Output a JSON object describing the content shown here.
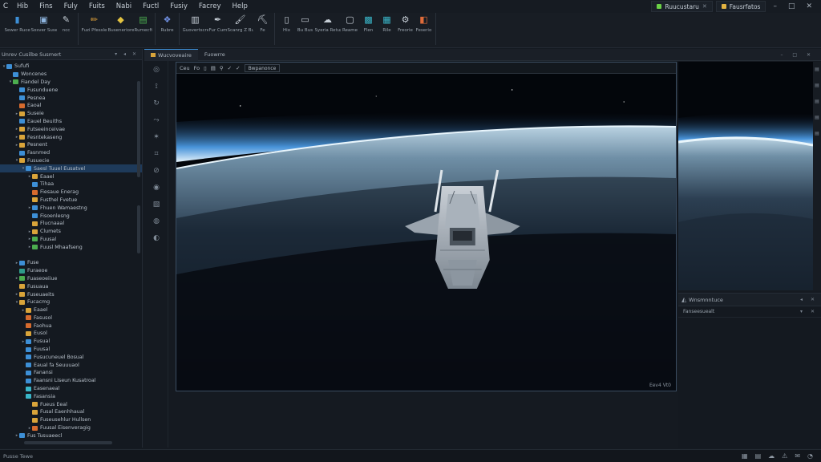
{
  "menu": {
    "logo": "C",
    "items": [
      "Hib",
      "Fins",
      "Fuly",
      "Fuits",
      "Nabi",
      "Fuctl",
      "Fusiy",
      "Facrey",
      "Help"
    ]
  },
  "title_tabs": [
    {
      "label": "Ruucustaru",
      "color": "#6bd146"
    },
    {
      "label": "Fausrfatos",
      "color": "#e3b341"
    }
  ],
  "window_controls": [
    "–",
    "□",
    "✕"
  ],
  "ribbon": {
    "groups": [
      {
        "buttons": [
          {
            "icon": "save-icon",
            "glyph": "▮",
            "color": "#3d8fd6",
            "label": "Sewer Rucet"
          },
          {
            "icon": "image-icon",
            "glyph": "▣",
            "color": "#8fb6e0",
            "label": "Sosver Susestiures"
          },
          {
            "icon": "brush-icon",
            "glyph": "✎",
            "color": "#c7cfd7",
            "label": "ncc"
          }
        ]
      },
      {
        "buttons": [
          {
            "icon": "pencil-icon",
            "glyph": "✏",
            "color": "#e0a23a",
            "label": "Fuzi Pfessle"
          },
          {
            "icon": "diamond-icon",
            "glyph": "◆",
            "color": "#e3c341",
            "label": "Buseneriore"
          },
          {
            "icon": "layers-icon",
            "glyph": "▤",
            "color": "#4cae4f",
            "label": "Rumecfiet"
          }
        ]
      },
      {
        "buttons": [
          {
            "icon": "shapes-icon",
            "glyph": "❖",
            "color": "#6f8fe0",
            "label": "Rubre"
          }
        ]
      },
      {
        "buttons": [
          {
            "icon": "clipboard-icon",
            "glyph": "▥",
            "color": "#c7cfd7",
            "label": "Guovertscrere Coanses"
          },
          {
            "icon": "pen-icon",
            "glyph": "✒",
            "color": "#c7cfd7",
            "label": "Fur Cumrs"
          },
          {
            "icon": "brush-tool-icon",
            "glyph": "🖌",
            "color": "#c7cfd7",
            "label": "Scanrg Z Bus"
          },
          {
            "icon": "fill-icon",
            "glyph": "⛏",
            "color": "#c7cfd7",
            "label": "Fe"
          }
        ]
      },
      {
        "buttons": [
          {
            "icon": "document-icon",
            "glyph": "▯",
            "color": "#c7cfd7",
            "label": "Hix"
          },
          {
            "icon": "file-icon",
            "glyph": "▭",
            "color": "#c7cfd7",
            "label": "Bu Bus"
          },
          {
            "icon": "cloud-icon",
            "glyph": "☁",
            "color": "#c7cfd7",
            "label": "Syeria Retuge"
          },
          {
            "icon": "monitor-icon",
            "glyph": "▢",
            "color": "#c7cfd7",
            "label": "Reame"
          },
          {
            "icon": "gallery-icon",
            "glyph": "▩",
            "color": "#39b6c9",
            "label": "Flen"
          },
          {
            "icon": "chart-icon",
            "glyph": "▦",
            "color": "#39b6c9",
            "label": "Rile"
          },
          {
            "icon": "settings-icon",
            "glyph": "⚙",
            "color": "#c7cfd7",
            "label": "Freorie"
          },
          {
            "icon": "tag-icon",
            "glyph": "◧",
            "color": "#e06c3a",
            "label": "Feserio"
          }
        ]
      }
    ]
  },
  "left_panel": {
    "title": "Unrev Cusilbe Susmert",
    "controls": "▾ ◂ ✕",
    "tree": [
      {
        "depth": 0,
        "arrow": "▾",
        "color": "blue",
        "label": "Sufufi"
      },
      {
        "depth": 1,
        "arrow": "",
        "color": "blue",
        "label": "Woncenes"
      },
      {
        "depth": 1,
        "arrow": "▾",
        "color": "green",
        "label": "Fiandel Day"
      },
      {
        "depth": 2,
        "arrow": "",
        "color": "blue",
        "label": "Fusunduene"
      },
      {
        "depth": 2,
        "arrow": "",
        "color": "blue",
        "label": "Pesnea"
      },
      {
        "depth": 2,
        "arrow": "",
        "color": "orange",
        "label": "Eaoal"
      },
      {
        "depth": 2,
        "arrow": "▸",
        "color": "yellow",
        "label": "Suseie"
      },
      {
        "depth": 2,
        "arrow": "",
        "color": "blue",
        "label": "Eauel Beuiths"
      },
      {
        "depth": 2,
        "arrow": "▸",
        "color": "yellow",
        "label": "Futseeinceivae"
      },
      {
        "depth": 2,
        "arrow": "▸",
        "color": "yellow",
        "label": "Fesntekaseng"
      },
      {
        "depth": 2,
        "arrow": "▸",
        "color": "yellow",
        "label": "Pesnent"
      },
      {
        "depth": 2,
        "arrow": "",
        "color": "blue",
        "label": "Fasnmed"
      },
      {
        "depth": 2,
        "arrow": "▾",
        "color": "yellow",
        "label": "Fusuecie"
      },
      {
        "depth": 3,
        "arrow": "▾",
        "color": "blue",
        "label": "Saesl Tuuel Eusatvel",
        "selected": true
      },
      {
        "depth": 4,
        "arrow": "▸",
        "color": "yellow",
        "label": "Eaael"
      },
      {
        "depth": 4,
        "arrow": "",
        "color": "blue",
        "label": "Tihaa"
      },
      {
        "depth": 4,
        "arrow": "",
        "color": "orange",
        "label": "Fiesaue Enerag"
      },
      {
        "depth": 4,
        "arrow": "",
        "color": "yellow",
        "label": "Fusthel Fvetue"
      },
      {
        "depth": 4,
        "arrow": "▸",
        "color": "blue",
        "label": "Fhuen Wamaestng"
      },
      {
        "depth": 4,
        "arrow": "",
        "color": "blue",
        "label": "Fisoenlesng"
      },
      {
        "depth": 4,
        "arrow": "",
        "color": "yellow",
        "label": "Flucnaaal"
      },
      {
        "depth": 4,
        "arrow": "▸",
        "color": "yellow",
        "label": "Clumets"
      },
      {
        "depth": 4,
        "arrow": "▸",
        "color": "green",
        "label": "Fuusal"
      },
      {
        "depth": 4,
        "arrow": "▸",
        "color": "green",
        "label": "Fuusl Mhaafseng"
      },
      {
        "depth": 2,
        "arrow": "",
        "color": "",
        "label": ""
      },
      {
        "depth": 2,
        "arrow": "▸",
        "color": "blue",
        "label": "Fuse"
      },
      {
        "depth": 2,
        "arrow": "",
        "color": "teal",
        "label": "Furaeoe"
      },
      {
        "depth": 2,
        "arrow": "▸",
        "color": "green",
        "label": "Fuaseoeiiue"
      },
      {
        "depth": 2,
        "arrow": "",
        "color": "yellow",
        "label": "Fusuaua"
      },
      {
        "depth": 2,
        "arrow": "▸",
        "color": "yellow",
        "label": "Fuseuaeits"
      },
      {
        "depth": 2,
        "arrow": "▾",
        "color": "yellow",
        "label": "Fucacmg"
      },
      {
        "depth": 3,
        "arrow": "▸",
        "color": "yellow",
        "label": "Eaael"
      },
      {
        "depth": 3,
        "arrow": "",
        "color": "orange",
        "label": "Fasusol"
      },
      {
        "depth": 3,
        "arrow": "",
        "color": "orange",
        "label": "Faohua"
      },
      {
        "depth": 3,
        "arrow": "",
        "color": "yellow",
        "label": "Eusol"
      },
      {
        "depth": 3,
        "arrow": "▸",
        "color": "blue",
        "label": "Fusual"
      },
      {
        "depth": 3,
        "arrow": "",
        "color": "blue",
        "label": "Fuusal"
      },
      {
        "depth": 3,
        "arrow": "",
        "color": "blue",
        "label": "Fusucuneuel Bosual"
      },
      {
        "depth": 3,
        "arrow": "",
        "color": "blue",
        "label": "Eaual fa Seuuuaol"
      },
      {
        "depth": 3,
        "arrow": "",
        "color": "blue",
        "label": "Fanansi"
      },
      {
        "depth": 3,
        "arrow": "",
        "color": "blue",
        "label": "Faansni Liseun Kusatroal"
      },
      {
        "depth": 3,
        "arrow": "",
        "color": "cyan",
        "label": "Easenaeal"
      },
      {
        "depth": 3,
        "arrow": "",
        "color": "cyan",
        "label": "Fasansia"
      },
      {
        "depth": 4,
        "arrow": "",
        "color": "yellow",
        "label": "Fueus Eeal"
      },
      {
        "depth": 4,
        "arrow": "",
        "color": "yellow",
        "label": "Fusal Eaenhhaual"
      },
      {
        "depth": 4,
        "arrow": "",
        "color": "yellow",
        "label": "Fuseusehlur Hullsen"
      },
      {
        "depth": 4,
        "arrow": "▸",
        "color": "orange",
        "label": "Fuusal Eisenveragig"
      },
      {
        "depth": 2,
        "arrow": "▸",
        "color": "blue",
        "label": "Fus Tusuaeecl"
      }
    ]
  },
  "tools": [
    {
      "icon": "target-icon",
      "glyph": "◎"
    },
    {
      "icon": "lasso-icon",
      "glyph": "⟟"
    },
    {
      "icon": "rotate-icon",
      "glyph": "↻"
    },
    {
      "icon": "curve-icon",
      "glyph": "⤳"
    },
    {
      "icon": "star-icon",
      "glyph": "✶"
    },
    {
      "icon": "crop-icon",
      "glyph": "⌗"
    },
    {
      "icon": "link-icon",
      "glyph": "⊘"
    },
    {
      "icon": "eye-icon",
      "glyph": "◉"
    },
    {
      "icon": "image-tool-icon",
      "glyph": "▧"
    },
    {
      "icon": "globe-icon",
      "glyph": "◍"
    },
    {
      "icon": "mask-icon",
      "glyph": "◐"
    }
  ],
  "doc_tabs": {
    "tabs": [
      "Wucvoveaire",
      "Fuowrre"
    ],
    "controls": "– □ ✕"
  },
  "viewport": {
    "toolbar": [
      "Ceu",
      "Fo",
      "▯",
      "▤",
      "⚲",
      "✓",
      "✓"
    ],
    "mode_label": "Bwpanonce",
    "status": "Eev4 Vt0"
  },
  "right_side_controls": [
    "▤",
    "▤",
    "▤",
    "▤",
    "▤"
  ],
  "properties": {
    "title": "Wnsmnntuce",
    "controls": "◂ ✕",
    "row_label": "Fanseesuealt",
    "row_controls": "▾ ✕"
  },
  "status_bar": {
    "text": "Pusse Tewe",
    "icons": [
      "grid-icon",
      "layers-status-icon",
      "cloud-status-icon",
      "warning-icon",
      "chat-icon",
      "user-icon"
    ],
    "glyphs": [
      "▦",
      "▤",
      "☁",
      "⚠",
      "✉",
      "◔"
    ]
  }
}
